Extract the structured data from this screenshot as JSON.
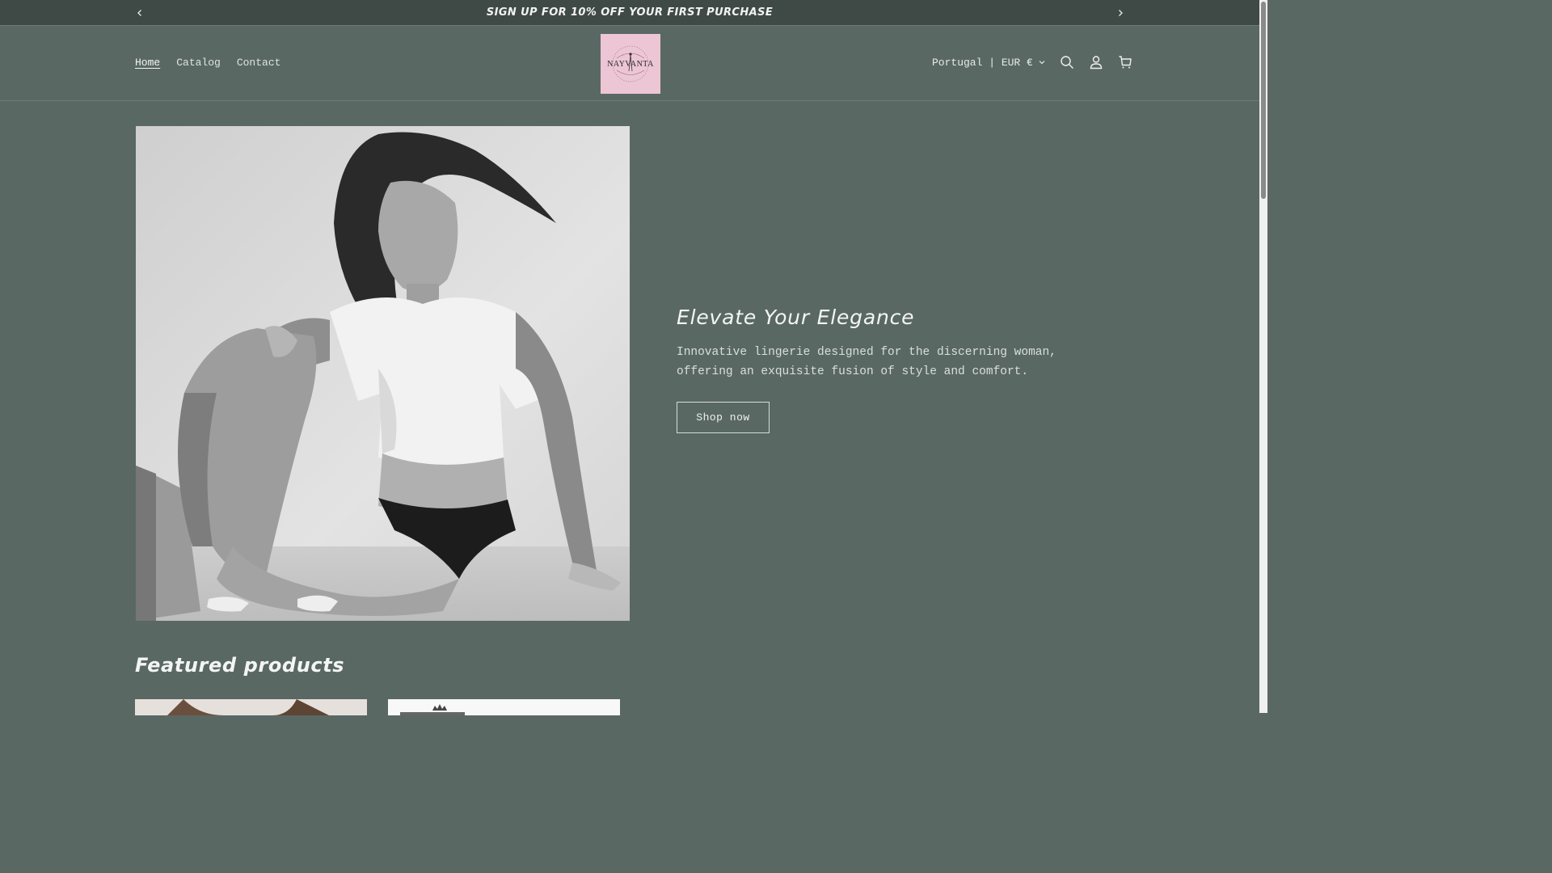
{
  "announcement": {
    "message": "SIGN UP FOR 10% OFF YOUR FIRST PURCHASE"
  },
  "header": {
    "nav": [
      {
        "label": "Home",
        "active": true
      },
      {
        "label": "Catalog",
        "active": false
      },
      {
        "label": "Contact",
        "active": false
      }
    ],
    "logo_text": "NAYVANTA",
    "locale": "Portugal | EUR €",
    "icons": [
      "search-icon",
      "account-icon",
      "cart-icon"
    ]
  },
  "hero": {
    "title": "Elevate Your Elegance",
    "description": "Innovative lingerie designed for the discerning woman, offering an exquisite fusion of style and comfort.",
    "button_label": "Shop now"
  },
  "featured": {
    "title": "Featured products"
  },
  "colors": {
    "background": "#5a6864",
    "announcement_bg": "#3f4a47",
    "logo_bg": "#ecc6d4"
  }
}
